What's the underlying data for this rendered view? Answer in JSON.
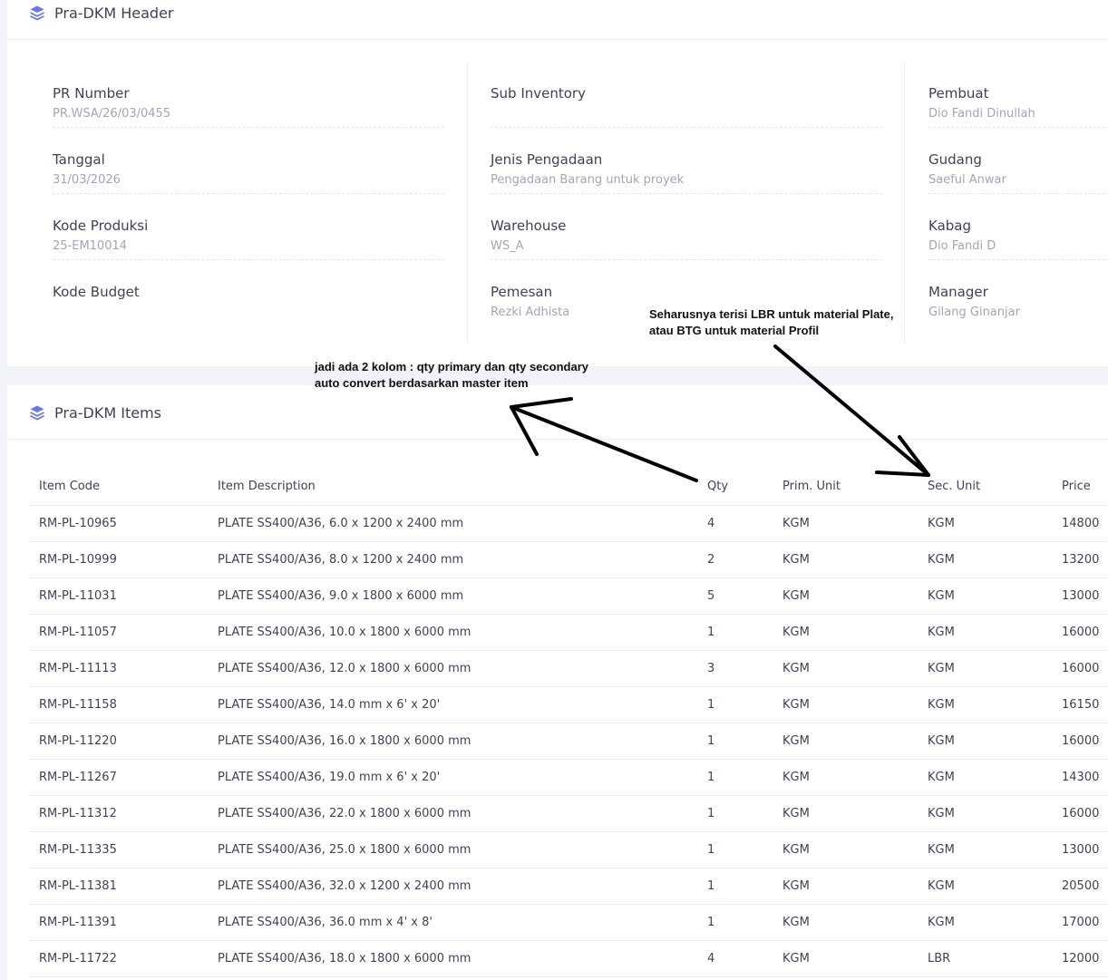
{
  "header_card": {
    "title": "Pra-DKM Header",
    "icon": "layers-icon",
    "col1": [
      {
        "label": "PR Number",
        "value": "PR.WSA/26/03/0455"
      },
      {
        "label": "Tanggal",
        "value": "31/03/2026"
      },
      {
        "label": "Kode Produksi",
        "value": "25-EM10014"
      },
      {
        "label": "Kode Budget",
        "value": ""
      }
    ],
    "col2": [
      {
        "label": "Sub Inventory",
        "value": ""
      },
      {
        "label": "Jenis Pengadaan",
        "value": "Pengadaan Barang untuk proyek"
      },
      {
        "label": "Warehouse",
        "value": "WS_A"
      },
      {
        "label": "Pemesan",
        "value": "Rezki Adhista"
      }
    ],
    "col3": [
      {
        "label": "Pembuat",
        "value": "Dio Fandi Dinullah"
      },
      {
        "label": "Gudang",
        "value": "Saeful Anwar"
      },
      {
        "label": "Kabag",
        "value": "Dio Fandi D"
      },
      {
        "label": "Manager",
        "value": "Gilang Ginanjar"
      }
    ]
  },
  "items_card": {
    "title": "Pra-DKM Items",
    "icon": "layers-icon",
    "columns": [
      "Item Code",
      "Item Description",
      "Qty",
      "Prim. Unit",
      "Sec. Unit",
      "Price"
    ],
    "rows": [
      [
        "RM-PL-10965",
        "PLATE SS400/A36, 6.0 x 1200 x 2400 mm",
        "4",
        "KGM",
        "KGM",
        "14800"
      ],
      [
        "RM-PL-10999",
        "PLATE SS400/A36, 8.0 x 1200 x 2400 mm",
        "2",
        "KGM",
        "KGM",
        "13200"
      ],
      [
        "RM-PL-11031",
        "PLATE SS400/A36, 9.0 x 1800 x 6000 mm",
        "5",
        "KGM",
        "KGM",
        "13000"
      ],
      [
        "RM-PL-11057",
        "PLATE SS400/A36, 10.0 x 1800 x 6000 mm",
        "1",
        "KGM",
        "KGM",
        "16000"
      ],
      [
        "RM-PL-11113",
        "PLATE SS400/A36, 12.0 x 1800 x 6000 mm",
        "3",
        "KGM",
        "KGM",
        "16000"
      ],
      [
        "RM-PL-11158",
        "PLATE SS400/A36, 14.0 mm x 6' x 20'",
        "1",
        "KGM",
        "KGM",
        "16150"
      ],
      [
        "RM-PL-11220",
        "PLATE SS400/A36, 16.0 x 1800 x 6000 mm",
        "1",
        "KGM",
        "KGM",
        "16000"
      ],
      [
        "RM-PL-11267",
        "PLATE SS400/A36, 19.0 mm x 6' x 20'",
        "1",
        "KGM",
        "KGM",
        "14300"
      ],
      [
        "RM-PL-11312",
        "PLATE SS400/A36, 22.0 x 1800 x 6000 mm",
        "1",
        "KGM",
        "KGM",
        "16000"
      ],
      [
        "RM-PL-11335",
        "PLATE SS400/A36, 25.0 x 1800 x 6000 mm",
        "1",
        "KGM",
        "KGM",
        "13000"
      ],
      [
        "RM-PL-11381",
        "PLATE SS400/A36, 32.0 x 1200 x 2400 mm",
        "1",
        "KGM",
        "KGM",
        "20500"
      ],
      [
        "RM-PL-11391",
        "PLATE SS400/A36, 36.0 mm x 4' x 8'",
        "1",
        "KGM",
        "KGM",
        "17000"
      ],
      [
        "RM-PL-11722",
        "PLATE SS400/A36, 18.0 x 1800 x 6000 mm",
        "4",
        "KGM",
        "LBR",
        "12000"
      ]
    ]
  },
  "annotations": {
    "sec_unit_note_line1": "Seharusnya terisi LBR untuk material Plate,",
    "sec_unit_note_line2": "atau BTG untuk material Profil",
    "qty_note_line1": "jadi ada 2 kolom : qty primary dan qty secondary",
    "qty_note_line2": "auto convert berdasarkan master item"
  },
  "colors": {
    "accent": "#6777ef",
    "label": "#3f4254",
    "muted": "#a1a5b7"
  }
}
